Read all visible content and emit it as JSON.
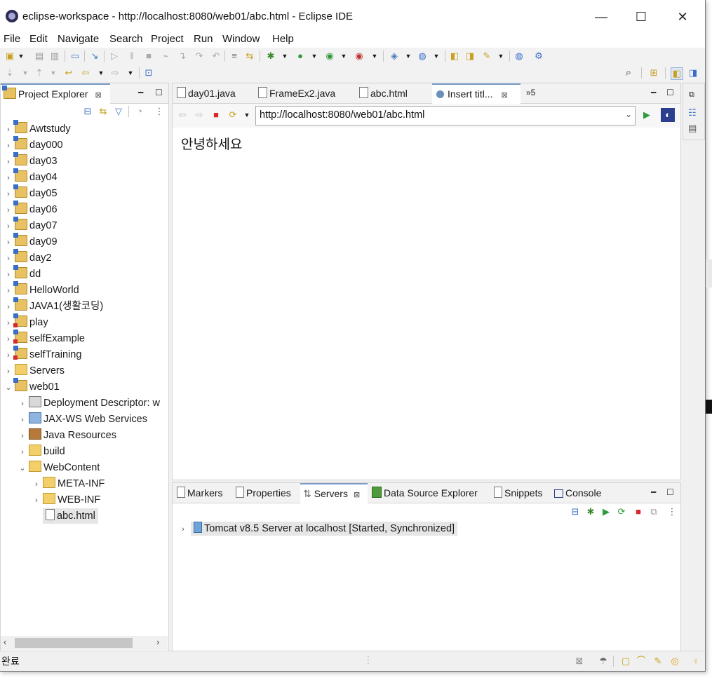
{
  "window": {
    "title": "eclipse-workspace - http://localhost:8080/web01/abc.html - Eclipse IDE",
    "minimize": "—",
    "maximize": "☐",
    "close": "✕"
  },
  "menu": [
    "File",
    "Edit",
    "Navigate",
    "Search",
    "Project",
    "Run",
    "Window",
    "Help"
  ],
  "project_explorer": {
    "title": "Project Explorer",
    "close_glyph": "⊠",
    "items": [
      {
        "label": "Awtstudy",
        "icon": "project-icon"
      },
      {
        "label": "day000",
        "icon": "project-icon"
      },
      {
        "label": "day03",
        "icon": "project-icon"
      },
      {
        "label": "day04",
        "icon": "project-icon"
      },
      {
        "label": "day05",
        "icon": "project-icon"
      },
      {
        "label": "day06",
        "icon": "project-icon"
      },
      {
        "label": "day07",
        "icon": "project-icon"
      },
      {
        "label": "day09",
        "icon": "project-icon"
      },
      {
        "label": "day2",
        "icon": "project-icon"
      },
      {
        "label": "dd",
        "icon": "project-icon"
      },
      {
        "label": "HelloWorld",
        "icon": "project-icon"
      },
      {
        "label": "JAVA1(생활코딩)",
        "icon": "project-icon"
      },
      {
        "label": "play",
        "icon": "project-error-icon"
      },
      {
        "label": "selfExample",
        "icon": "project-error-icon"
      },
      {
        "label": "selfTraining",
        "icon": "project-error-icon"
      },
      {
        "label": "Servers",
        "icon": "folder-icon"
      },
      {
        "label": "web01",
        "icon": "web-project-icon"
      },
      {
        "label": "Deployment Descriptor: w",
        "icon": "deployment-descriptor-icon"
      },
      {
        "label": "JAX-WS Web Services",
        "icon": "web-services-icon"
      },
      {
        "label": "Java Resources",
        "icon": "java-resources-icon"
      },
      {
        "label": "build",
        "icon": "folder-icon"
      },
      {
        "label": "WebContent",
        "icon": "folder-icon"
      },
      {
        "label": "META-INF",
        "icon": "folder-icon"
      },
      {
        "label": "WEB-INF",
        "icon": "folder-icon"
      },
      {
        "label": "abc.html",
        "icon": "html-file-icon"
      }
    ]
  },
  "editor_tabs": [
    {
      "label": "day01.java"
    },
    {
      "label": "FrameEx2.java"
    },
    {
      "label": "abc.html"
    },
    {
      "label": "Insert titl..."
    }
  ],
  "tab_close_glyph": "⊠",
  "overflow_tabs": "»5",
  "browser": {
    "url": "http://localhost:8080/web01/abc.html",
    "content_text": "안녕하세요"
  },
  "bottom_tabs": [
    {
      "label": "Markers"
    },
    {
      "label": "Properties"
    },
    {
      "label": "Servers"
    },
    {
      "label": "Data Source Explorer"
    },
    {
      "label": "Snippets"
    },
    {
      "label": "Console"
    }
  ],
  "servers": [
    {
      "label": "Tomcat v8.5 Server at localhost  [Started, Synchronized]"
    }
  ],
  "status": {
    "text": "완료"
  },
  "colors": {
    "accent": "#7a9cc8",
    "selection": "#e6e6e6",
    "stop_red": "#d62b2b",
    "run_green": "#2e9b3a"
  }
}
